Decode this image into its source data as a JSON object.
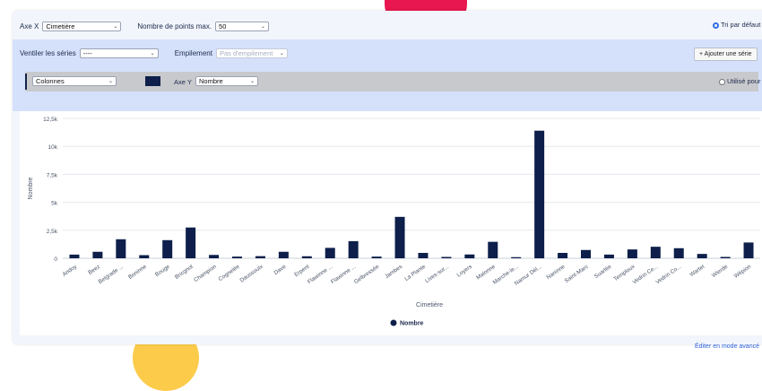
{
  "toolbar": {
    "axe_x_label": "Axe X",
    "axe_x_value": "Cimetière",
    "max_points_label": "Nombre de points max.",
    "max_points_value": "50",
    "default_sort_label": "Tri par défaut"
  },
  "series_panel": {
    "split_label": "Ventiler les séries",
    "split_value": "----",
    "stack_label": "Empilement",
    "stack_value": "Pas d'empilement",
    "add_series_label": "+ Ajouter une série",
    "series": [
      {
        "chart_type": "Colonnes",
        "color": "#0d1f4a",
        "axe_y_label": "Axe Y",
        "axe_y_value": "Nombre",
        "sort_label": "Utilisé pour le tri"
      }
    ]
  },
  "footer": {
    "edit_advanced_label": "Éditer en mode avancé"
  },
  "colors": {
    "bar": "#0d1f4a",
    "accent_red": "#e8174f",
    "accent_yellow": "#fccb4a",
    "band": "#d5e1fb"
  },
  "chart_data": {
    "type": "bar",
    "categories": [
      "Andoy",
      "Beez",
      "Belgrade ...",
      "Boninne",
      "Bouge",
      "Bricgnot",
      "Champion",
      "Cognelée",
      "Daussoulx",
      "Dave",
      "Erpent",
      "Flawinne ...",
      "Flawinne ...",
      "Gelbressée",
      "Jambes",
      "La Plante",
      "Lives-sur...",
      "Loyers",
      "Malonne",
      "Marche-le...",
      "Namur Dél...",
      "Naninne",
      "Saint-Marc",
      "Suarlée",
      "Temploux",
      "Vedrin Ce...",
      "Vedrin Co...",
      "Wartet",
      "Wierde",
      "Wépion"
    ],
    "series": [
      {
        "name": "Nombre",
        "values": [
          330,
          580,
          1700,
          280,
          1620,
          2750,
          300,
          150,
          190,
          580,
          180,
          930,
          1530,
          150,
          3700,
          480,
          120,
          340,
          1470,
          100,
          11400,
          480,
          740,
          330,
          790,
          1030,
          900,
          390,
          120,
          1410
        ]
      }
    ],
    "xlabel": "Cimetière",
    "ylabel": "Nombre",
    "yticks": [
      "0",
      "2,5k",
      "5k",
      "7,5k",
      "10k",
      "12,5k"
    ],
    "ylim": [
      0,
      12500
    ],
    "grid": true,
    "legend": "bottom"
  }
}
